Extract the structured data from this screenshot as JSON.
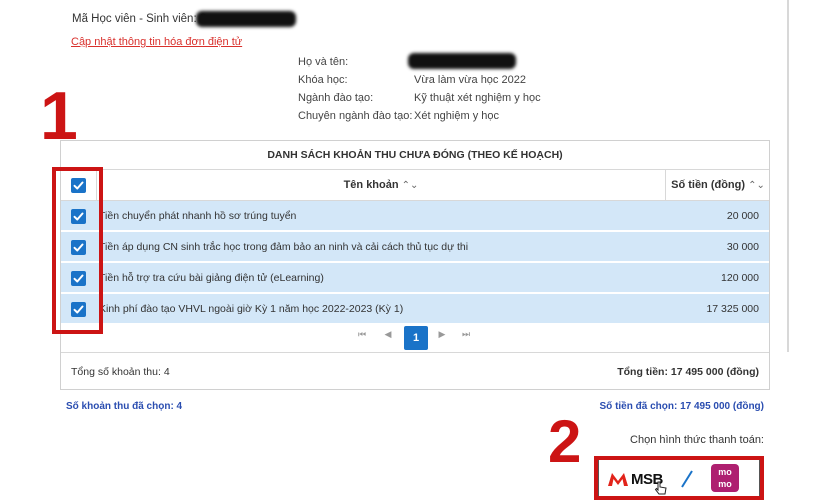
{
  "header": {
    "student_id_label": "Mã Học viên - Sinh viên: 2",
    "update_invoice_link": "Cập nhật thông tin hóa đơn điện tử"
  },
  "info": {
    "name_label": "Họ và tên:",
    "course_label": "Khóa học:",
    "course_value": "Vừa làm vừa học 2022",
    "major_label": "Ngành đào tạo:",
    "major_value": "Kỹ thuật xét nghiệm y học",
    "specialization_label": "Chuyên ngành đào tạo:",
    "specialization_value": "Xét nghiệm y học"
  },
  "table": {
    "title": "DANH SÁCH KHOẢN THU CHƯA ĐÓNG (THEO KẾ HOẠCH)",
    "col_name": "Tên khoản",
    "col_amount": "Số tiền (đồng)",
    "rows": [
      {
        "name": "Tiền chuyển phát nhanh hồ sơ trúng tuyển",
        "amount": "20 000"
      },
      {
        "name": "Tiền áp dụng CN sinh trắc học trong đảm bảo an ninh và cải cách thủ tục dự thi",
        "amount": "30 000"
      },
      {
        "name": "Tiền hỗ trợ tra cứu bài giảng điện tử (eLearning)",
        "amount": "120 000"
      },
      {
        "name": "Kinh phí đào tạo VHVL ngoài giờ Kỳ 1 năm học 2022-2023 (Kỳ 1)",
        "amount": "17 325 000"
      }
    ],
    "pager": {
      "current": "1",
      "first": "⏮",
      "prev": "◀",
      "next": "▶",
      "last": "⏭"
    },
    "total_count": "Tổng số khoản thu: 4",
    "total_amount": "Tổng tiền: 17 495 000 (đồng)"
  },
  "selection": {
    "count": "Số khoản thu đã chọn: 4",
    "amount": "Số tiền đã chọn: 17 495 000 (đồng)",
    "payment_label": "Chọn hình thức thanh toán:"
  },
  "payment": {
    "msb_label": "MSB",
    "momo_line1": "mo",
    "momo_line2": "mo"
  },
  "annotations": {
    "marker1": "1",
    "marker2": "2"
  },
  "colors": {
    "accent": "#1a73c8",
    "row_highlight": "#d3e7f8",
    "annotation_red": "#cc1414",
    "link_red": "#d9302c",
    "selected_text": "#2a4db0",
    "momo": "#ae2070"
  }
}
